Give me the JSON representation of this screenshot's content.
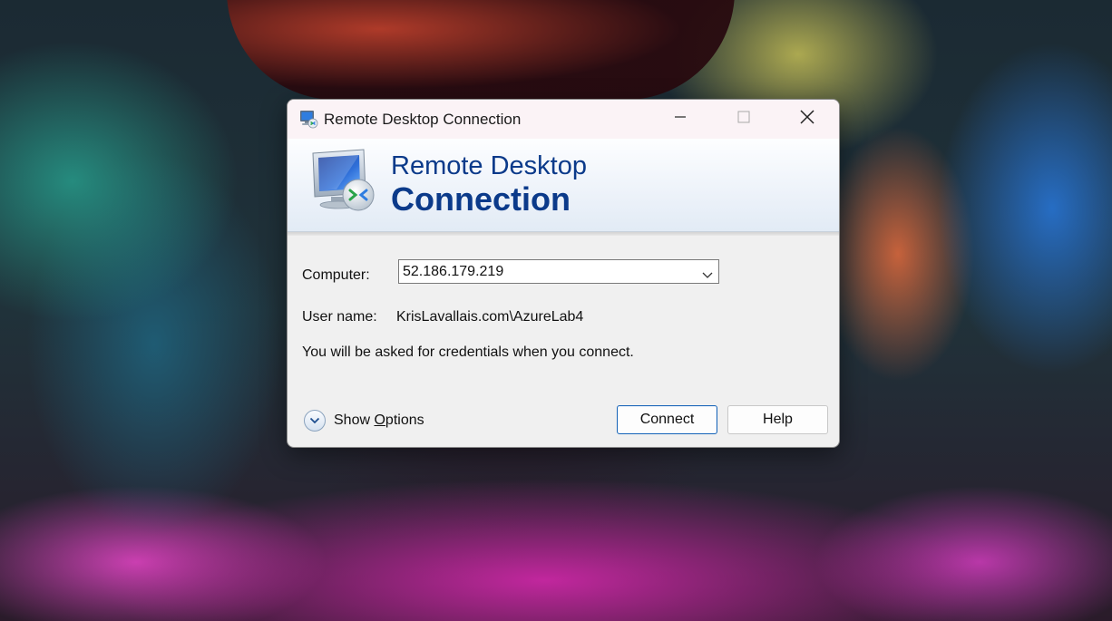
{
  "window": {
    "title": "Remote Desktop Connection",
    "minimize_glyph": "—",
    "close_glyph": "✕"
  },
  "banner": {
    "line1": "Remote Desktop",
    "line2": "Connection",
    "icon": "remote-desktop-monitor-icon"
  },
  "form": {
    "computer_label": "Computer:",
    "computer_value": "52.186.179.219",
    "username_label": "User name:",
    "username_value": "KrisLavallais.com\\AzureLab4",
    "credentials_note": "You will be asked for credentials when you connect."
  },
  "footer": {
    "show_options_prefix": "Show ",
    "show_options_accel": "O",
    "show_options_suffix": "ptions",
    "connect_label": "Connect",
    "help_label": "Help"
  },
  "colors": {
    "banner_text": "#0b3a8a",
    "dialog_bg": "#f0f0f0",
    "primary_border": "#1a66b8"
  }
}
